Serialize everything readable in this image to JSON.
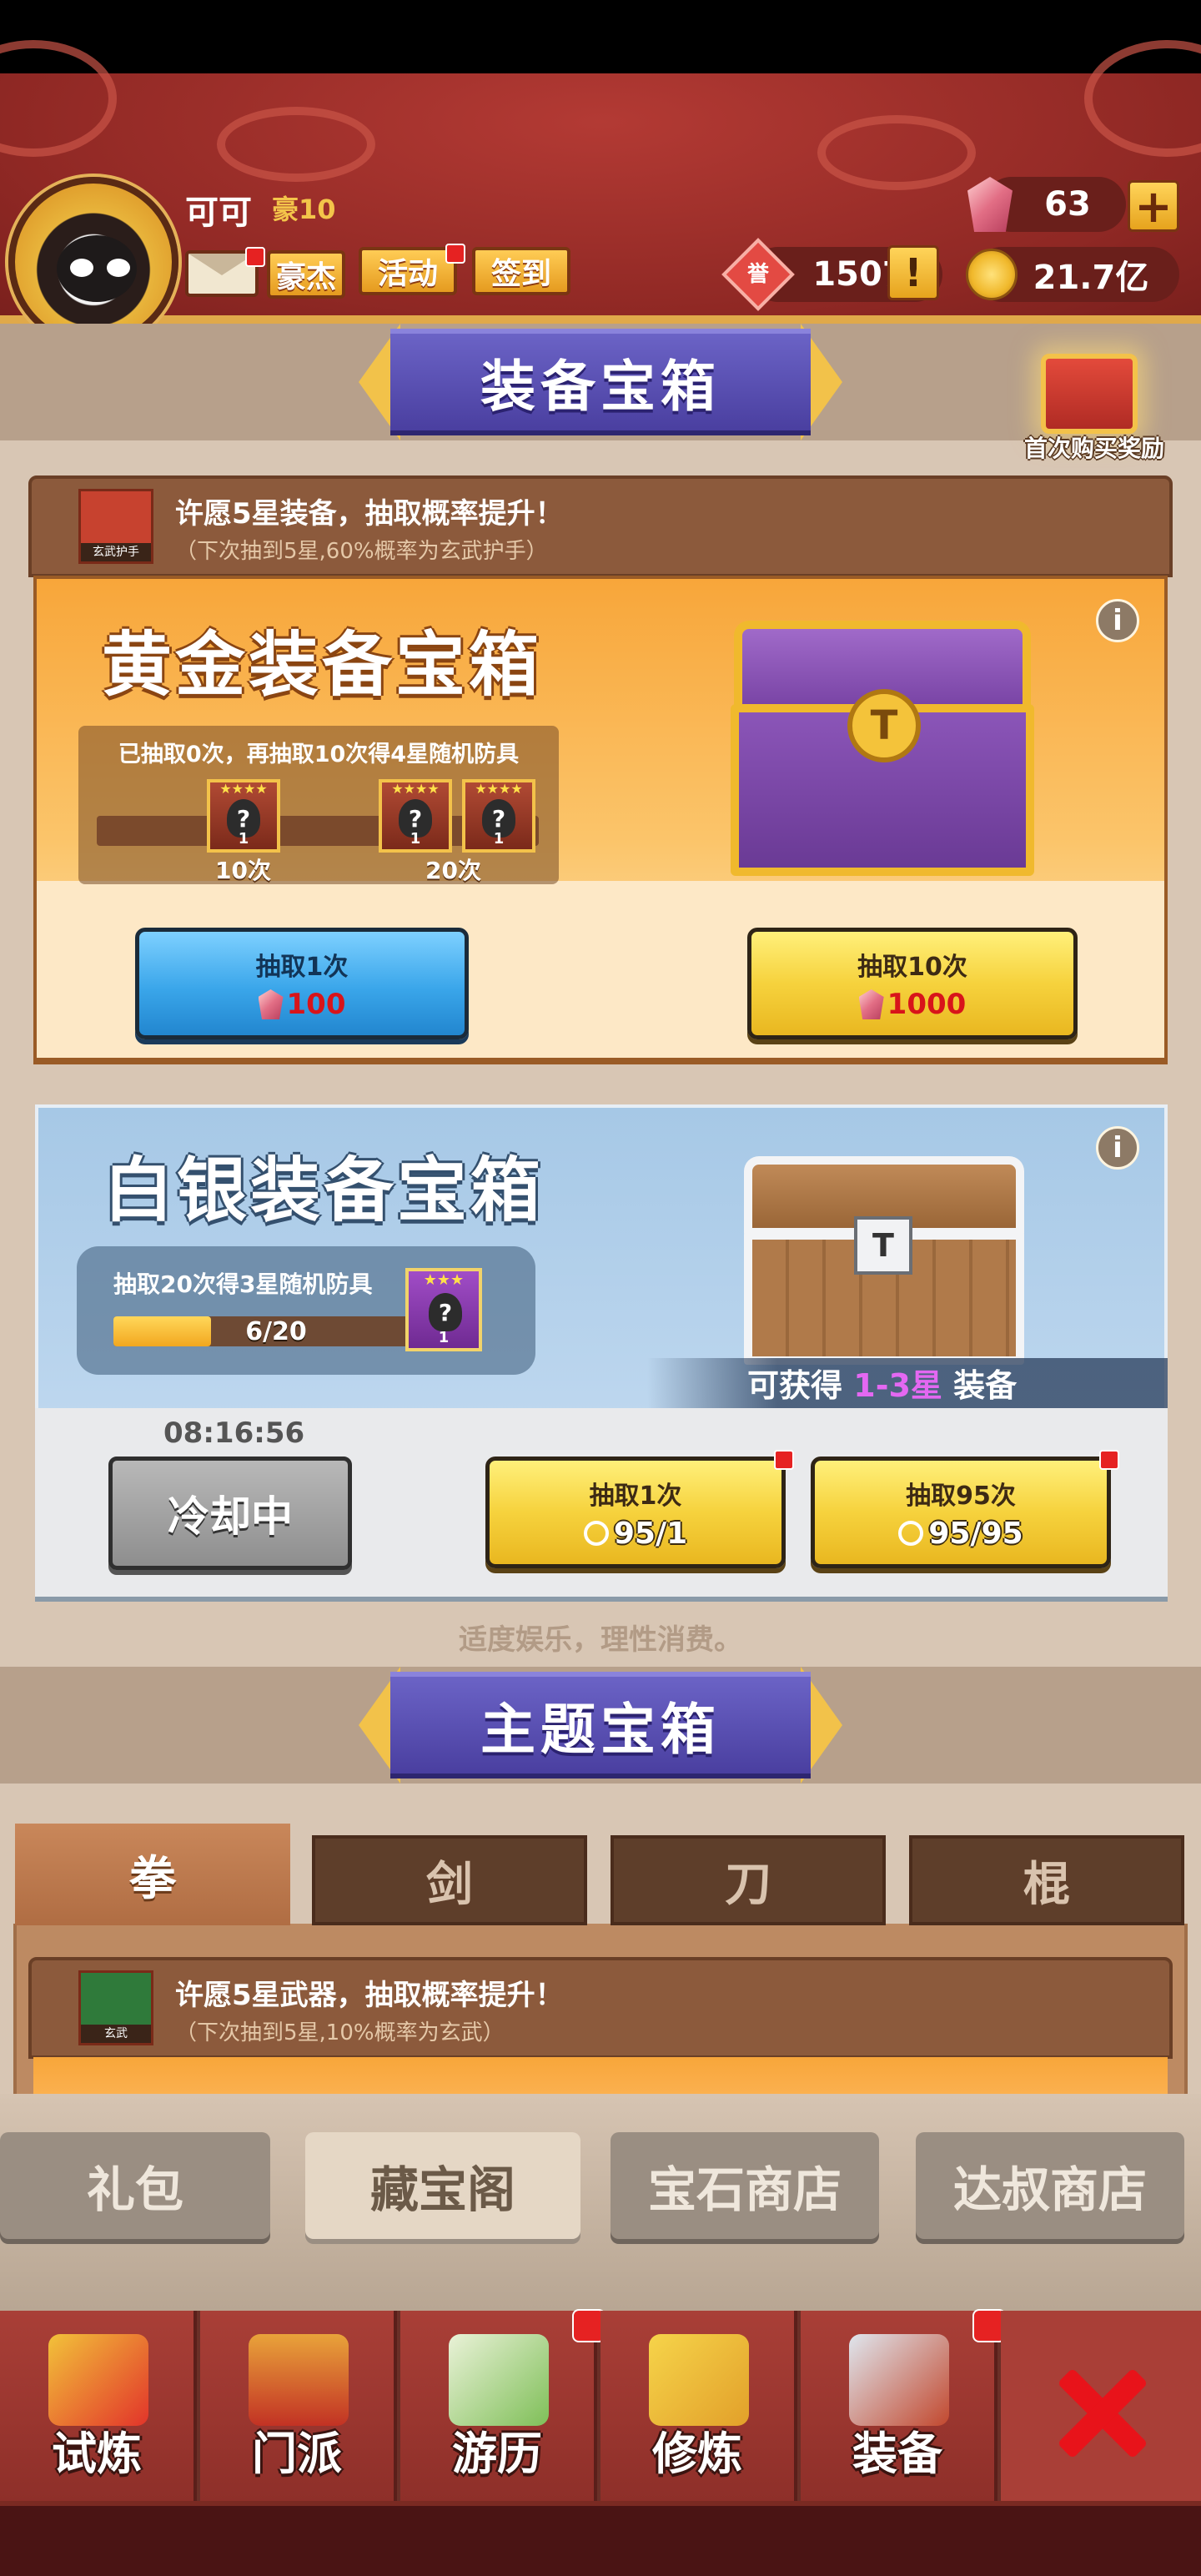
{
  "header": {
    "player_name": "可可",
    "player_rank": "豪10",
    "buttons": {
      "hero": "豪杰",
      "events": "活动",
      "signin": "签到"
    },
    "resources": {
      "gems": "63",
      "honor": "1507",
      "coins": "21.7亿",
      "honor_icon_char": "誉",
      "honor_alert": "!",
      "plus": "+"
    }
  },
  "equipment_section": {
    "title": "装备宝箱",
    "first_buy_label": "首次购买奖励",
    "wish": {
      "title": "许愿5星装备，抽取概率提升！",
      "subtitle": "（下次抽到5星,60%概率为玄武护手）",
      "icon_caption": "玄武护手"
    },
    "gold": {
      "title": "黄金装备宝箱",
      "progress_text": "已抽取0次，再抽取10次得4星随机防具",
      "milestones": [
        {
          "label": "10次",
          "stars": "★★★★",
          "count": "1"
        },
        {
          "label": "20次",
          "stars": "★★★★",
          "count": "1"
        },
        {
          "label": "",
          "stars": "★★★★",
          "count": "1"
        }
      ],
      "draw1": {
        "label": "抽取1次",
        "cost": "100"
      },
      "draw10": {
        "label": "抽取10次",
        "cost": "1000"
      },
      "info": "i"
    },
    "silver": {
      "title": "白银装备宝箱",
      "progress_text": "抽取20次得3星随机防具",
      "progress_value": "6/20",
      "progress_fraction": 0.3,
      "reward_stars": "★★★",
      "reward_count": "1",
      "reward_prefix": "可获得",
      "reward_highlight": "1-3星",
      "reward_suffix": "装备",
      "cooldown_timer": "08:16:56",
      "cooldown_label": "冷却中",
      "draw1": {
        "label": "抽取1次",
        "cost": "95/1"
      },
      "draw95": {
        "label": "抽取95次",
        "cost": "95/95"
      },
      "info": "i"
    },
    "footer_note": "适度娱乐，理性消费。"
  },
  "theme_section": {
    "title": "主题宝箱",
    "tabs": [
      "拳",
      "剑",
      "刀",
      "棍"
    ],
    "wish": {
      "title": "许愿5星武器，抽取概率提升！",
      "subtitle": "（下次抽到5星,10%概率为玄武）",
      "icon_caption": "玄武"
    }
  },
  "shop_tabs": [
    "礼包",
    "藏宝阁",
    "宝石商店",
    "达叔商店"
  ],
  "bottom_nav": [
    "试炼",
    "门派",
    "游历",
    "修炼",
    "装备"
  ],
  "colors": {
    "header_red": "#8f2824",
    "banner_purple": "#4a3fa0",
    "gold_orange": "#f8a63a",
    "silver_blue": "#a6c8e6",
    "button_yellow": "#f6d23d",
    "button_blue": "#3aa6ea",
    "highlight_purple": "#e468f2",
    "close_red": "#e8131a"
  }
}
